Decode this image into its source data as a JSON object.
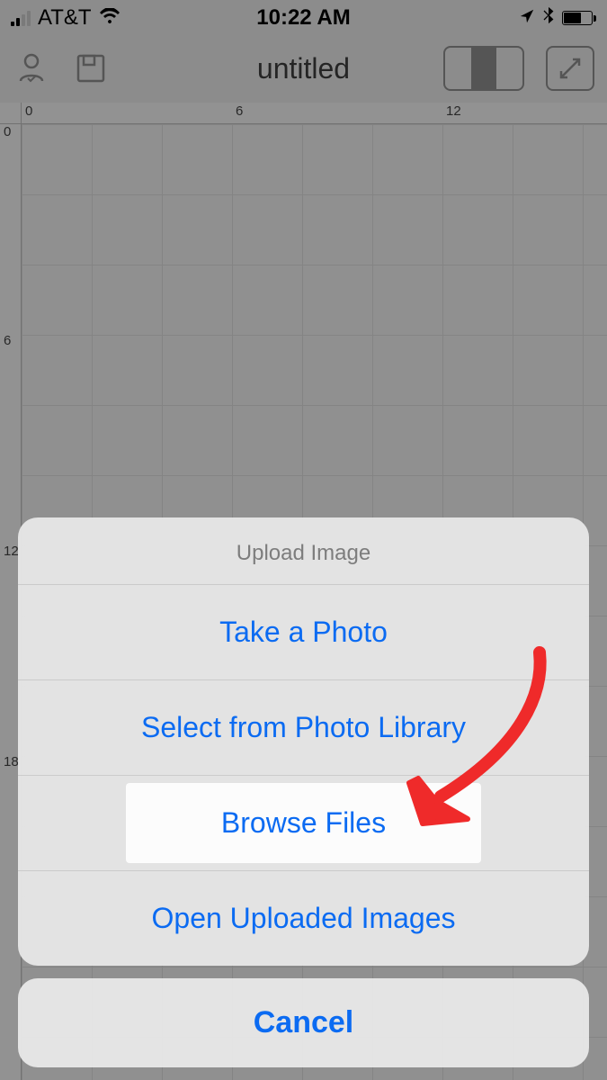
{
  "status": {
    "carrier": "AT&T",
    "time": "10:22 AM"
  },
  "toolbar": {
    "title": "untitled"
  },
  "rulers": {
    "h": {
      "n0": "0",
      "n6": "6",
      "n12": "12"
    },
    "v": {
      "n0": "0",
      "n6": "6",
      "n12": "12",
      "n18": "18"
    }
  },
  "sheet": {
    "title": "Upload Image",
    "take_photo": "Take a Photo",
    "select_library": "Select from Photo Library",
    "browse_files": "Browse Files",
    "open_uploaded": "Open Uploaded Images",
    "cancel": "Cancel"
  }
}
